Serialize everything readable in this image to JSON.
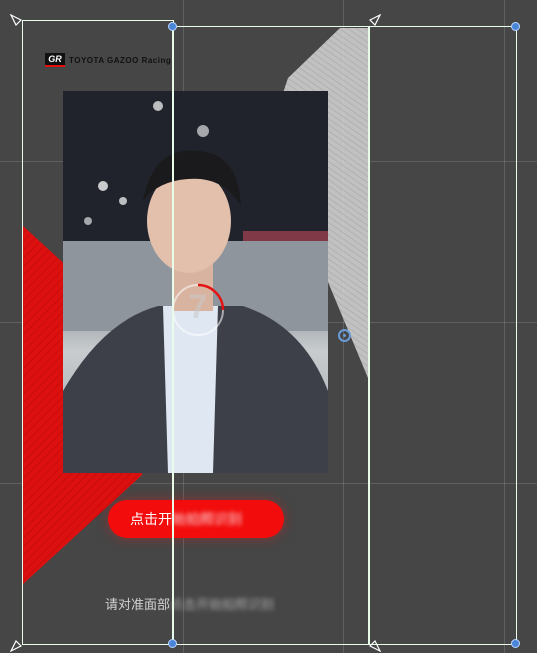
{
  "logo": {
    "mark": "GR",
    "text": "TOYOTA GAZOO Racing"
  },
  "cta": {
    "visible_label": "点击开",
    "blurred_label": "始拍照识别"
  },
  "hint": {
    "visible_label": "请对准面部",
    "blurred_label": "点击开始拍照识别"
  },
  "countdown": {
    "value": "7"
  },
  "colors": {
    "background": "#464646",
    "accent_red": "#f20c0c",
    "handle_blue": "#4a86d8",
    "frame": "#e9fbe9"
  },
  "icons": {
    "corner_handle": "triangle-corner-icon",
    "anchor_handle": "blue-dot-icon",
    "pivot": "pivot-ring-icon"
  }
}
